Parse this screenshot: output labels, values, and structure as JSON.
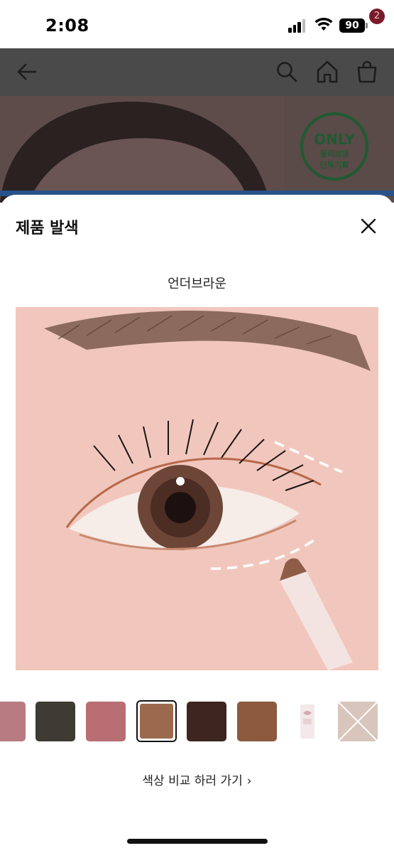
{
  "status_bar": {
    "time": "2:08",
    "battery": "90"
  },
  "header": {
    "cart_count": "2"
  },
  "hero": {
    "badge_line1": "ONLY",
    "badge_line2": "올리브영",
    "badge_line3": "단독기획"
  },
  "sheet": {
    "title": "제품 발색",
    "shade_name": "언더브라운",
    "compare_link": "색상 비교 하러 가기",
    "swatches": [
      {
        "color": "#b97b82"
      },
      {
        "color": "#3e3b35"
      },
      {
        "color": "#b86e72"
      },
      {
        "color": "#9b6a4e",
        "selected": true
      },
      {
        "color": "#3d2520"
      },
      {
        "color": "#8b5a3f"
      },
      {
        "color": "#f3e9ea"
      },
      {
        "color": "#d8c6bc"
      }
    ]
  },
  "colors": {
    "overlay": "#4a4a4a",
    "selected_border": "#111111",
    "badge": "#7a1a2a"
  }
}
